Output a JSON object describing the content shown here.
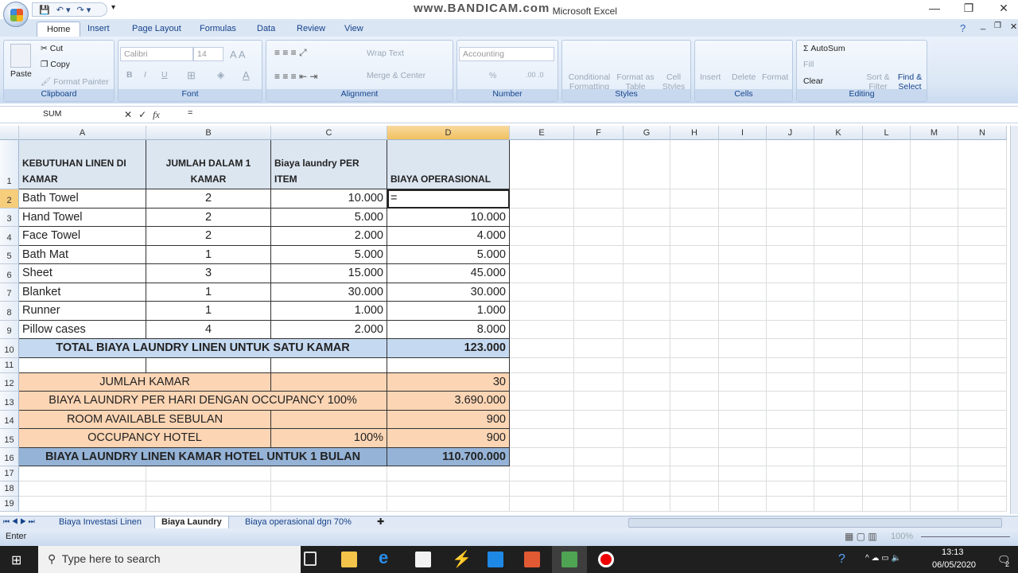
{
  "window": {
    "title": "Microsoft Excel",
    "watermark": "www.BANDICAM.com",
    "minimize": "—",
    "restore": "❐",
    "close": "✕"
  },
  "qat": {
    "save": "💾",
    "undo": "↶ ▾",
    "redo": "↷ ▾",
    "customize": "▾"
  },
  "ribbon_tabs": [
    "Home",
    "Insert",
    "Page Layout",
    "Formulas",
    "Data",
    "Review",
    "View"
  ],
  "ribbon": {
    "clipboard": {
      "label": "Clipboard",
      "paste": "Paste",
      "cut": "Cut",
      "copy": "Copy",
      "format_painter": "Format Painter"
    },
    "font": {
      "label": "Font",
      "font_name": "Calibri",
      "font_size": "14",
      "bold": "B",
      "italic": "I",
      "underline": "U"
    },
    "alignment": {
      "label": "Alignment",
      "wrap_text": "Wrap Text",
      "merge_center": "Merge & Center"
    },
    "number": {
      "label": "Number",
      "format": "Accounting",
      "percent": "%"
    },
    "styles": {
      "label": "Styles",
      "conditional": "Conditional Formatting",
      "format_table": "Format as Table",
      "cell_styles": "Cell Styles"
    },
    "cells": {
      "label": "Cells",
      "insert": "Insert",
      "delete": "Delete",
      "format": "Format"
    },
    "editing": {
      "label": "Editing",
      "autosum": "AutoSum",
      "fill": "Fill",
      "clear": "Clear",
      "sort_filter": "Sort & Filter",
      "find_select": "Find & Select"
    }
  },
  "formula_bar": {
    "name_box": "SUM",
    "cancel": "✕",
    "enter": "✓",
    "fx": "fx",
    "value": "="
  },
  "grid": {
    "columns": [
      "A",
      "B",
      "C",
      "D",
      "E",
      "F",
      "G",
      "H",
      "I",
      "J",
      "K",
      "L",
      "M",
      "N"
    ],
    "selected_column": "D",
    "selected_row": "2",
    "rows": [
      {
        "n": "1",
        "A": "KEBUTUHAN LINEN DI KAMAR",
        "B": "JUMLAH DALAM 1 KAMAR",
        "C": "Biaya laundry  PER ITEM",
        "D": "BIAYA OPERASIONAL"
      },
      {
        "n": "2",
        "A": "Bath Towel",
        "B": "2",
        "C": "10.000",
        "D": "="
      },
      {
        "n": "3",
        "A": "Hand Towel",
        "B": "2",
        "C": "5.000",
        "D": "10.000"
      },
      {
        "n": "4",
        "A": "Face Towel",
        "B": "2",
        "C": "2.000",
        "D": "4.000"
      },
      {
        "n": "5",
        "A": "Bath Mat",
        "B": "1",
        "C": "5.000",
        "D": "5.000"
      },
      {
        "n": "6",
        "A": "Sheet",
        "B": "3",
        "C": "15.000",
        "D": "45.000"
      },
      {
        "n": "7",
        "A": "Blanket",
        "B": "1",
        "C": "30.000",
        "D": "30.000"
      },
      {
        "n": "8",
        "A": "Runner",
        "B": "1",
        "C": "1.000",
        "D": "1.000"
      },
      {
        "n": "9",
        "A": "Pillow cases",
        "B": "4",
        "C": "2.000",
        "D": "8.000"
      },
      {
        "n": "10",
        "A": "TOTAL BIAYA LAUNDRY LINEN UNTUK SATU KAMAR",
        "D": "123.000"
      },
      {
        "n": "11"
      },
      {
        "n": "12",
        "A": "JUMLAH KAMAR",
        "D": "30"
      },
      {
        "n": "13",
        "A": "BIAYA LAUNDRY PER HARI DENGAN OCCUPANCY 100%",
        "D": "3.690.000"
      },
      {
        "n": "14",
        "A": "ROOM AVAILABLE SEBULAN",
        "D": "900"
      },
      {
        "n": "15",
        "A": "OCCUPANCY HOTEL",
        "C": "100%",
        "D": "900"
      },
      {
        "n": "16",
        "A": "BIAYA LAUNDRY LINEN KAMAR HOTEL UNTUK 1 BULAN",
        "D": "110.700.000"
      },
      {
        "n": "17"
      },
      {
        "n": "18"
      },
      {
        "n": "19"
      }
    ],
    "colors": {
      "header_fill": "#dce6f1",
      "total_fill": "#c5d9f1",
      "orange_fill": "#fcd5b4",
      "blue_fill": "#95b3d7"
    }
  },
  "sheet_tabs": [
    "Biaya Investasi Linen",
    "Biaya Laundry",
    "Biaya operasional dgn 70%"
  ],
  "active_sheet": "Biaya Laundry",
  "status": {
    "mode": "Enter",
    "zoom": "100%"
  },
  "taskbar": {
    "search_placeholder": "Type here to search",
    "time": "13:13",
    "date": "06/05/2020",
    "notifications": "2"
  }
}
